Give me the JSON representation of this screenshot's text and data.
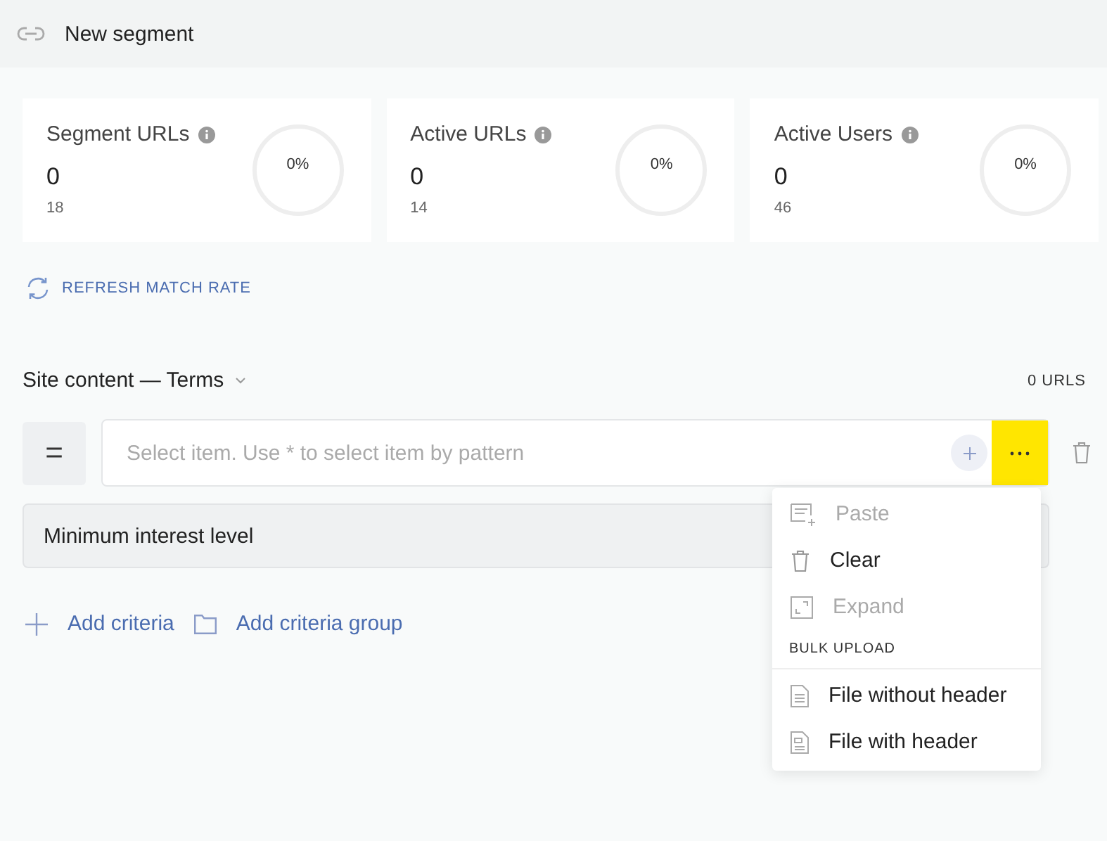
{
  "header": {
    "title": "New segment"
  },
  "metrics": [
    {
      "label": "Segment URLs",
      "value": "0",
      "total": "18",
      "percent": "0%",
      "level": 0
    },
    {
      "label": "Active URLs",
      "value": "0",
      "total": "14",
      "percent": "0%",
      "level": 0
    },
    {
      "label": "Active Users",
      "value": "0",
      "total": "46",
      "percent": "0%",
      "level": 0
    }
  ],
  "refresh": {
    "label": "REFRESH MATCH RATE"
  },
  "section": {
    "title": "Site content — Terms",
    "count": "0 URLS"
  },
  "criteria": {
    "operator": "=",
    "placeholder": "Select item. Use * to select item by pattern",
    "more_active": true
  },
  "interest": {
    "label": "Minimum interest level"
  },
  "actions": [
    "Add criteria",
    "Add criteria group"
  ],
  "menu": [
    {
      "kind": "item",
      "label": "Paste",
      "disabled": true
    },
    {
      "kind": "item",
      "label": "Clear",
      "disabled": false
    },
    {
      "kind": "item",
      "label": "Expand",
      "disabled": true
    },
    {
      "kind": "heading",
      "label": "BULK UPLOAD"
    },
    {
      "kind": "item",
      "label": "File without header",
      "disabled": false
    },
    {
      "kind": "item",
      "label": "File with header",
      "disabled": false
    }
  ]
}
